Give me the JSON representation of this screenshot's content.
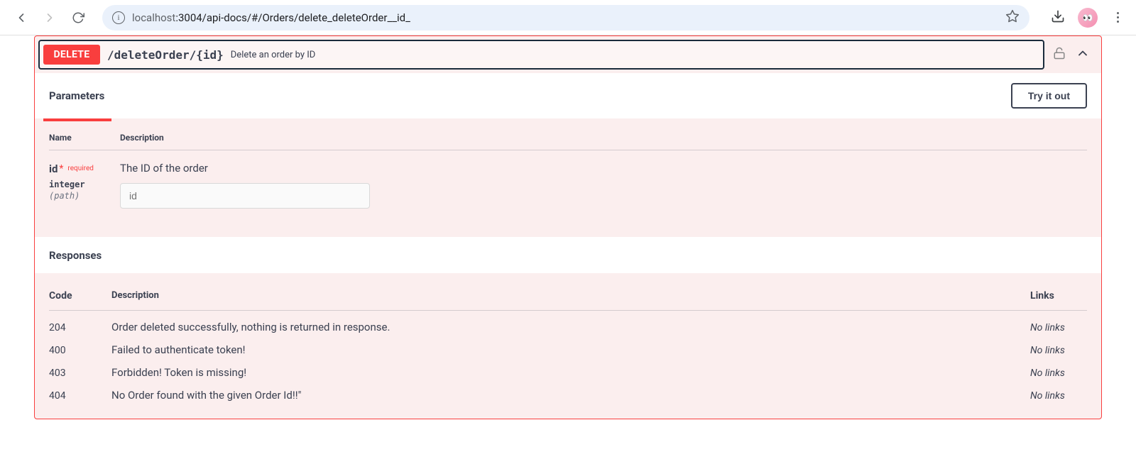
{
  "browser": {
    "url_host_dim": "localhost",
    "url_port_path": ":3004/api-docs/#/Orders/delete_deleteOrder__id_"
  },
  "operation": {
    "method": "DELETE",
    "path": "/deleteOrder/{id}",
    "summary": "Delete an order by ID"
  },
  "buttons": {
    "try_it_out": "Try it out"
  },
  "sections": {
    "parameters": "Parameters",
    "responses": "Responses"
  },
  "param_headers": {
    "name": "Name",
    "description": "Description"
  },
  "parameters": [
    {
      "name": "id",
      "required_label": "required",
      "type": "integer",
      "in": "(path)",
      "description": "The ID of the order",
      "placeholder": "id"
    }
  ],
  "response_headers": {
    "code": "Code",
    "description": "Description",
    "links": "Links"
  },
  "responses": [
    {
      "code": "204",
      "description": "Order deleted successfully, nothing is returned in response.",
      "links": "No links"
    },
    {
      "code": "400",
      "description": "Failed to authenticate token!",
      "links": "No links"
    },
    {
      "code": "403",
      "description": "Forbidden! Token is missing!",
      "links": "No links"
    },
    {
      "code": "404",
      "description": "No Order found with the given Order Id!!\"",
      "links": "No links"
    }
  ]
}
